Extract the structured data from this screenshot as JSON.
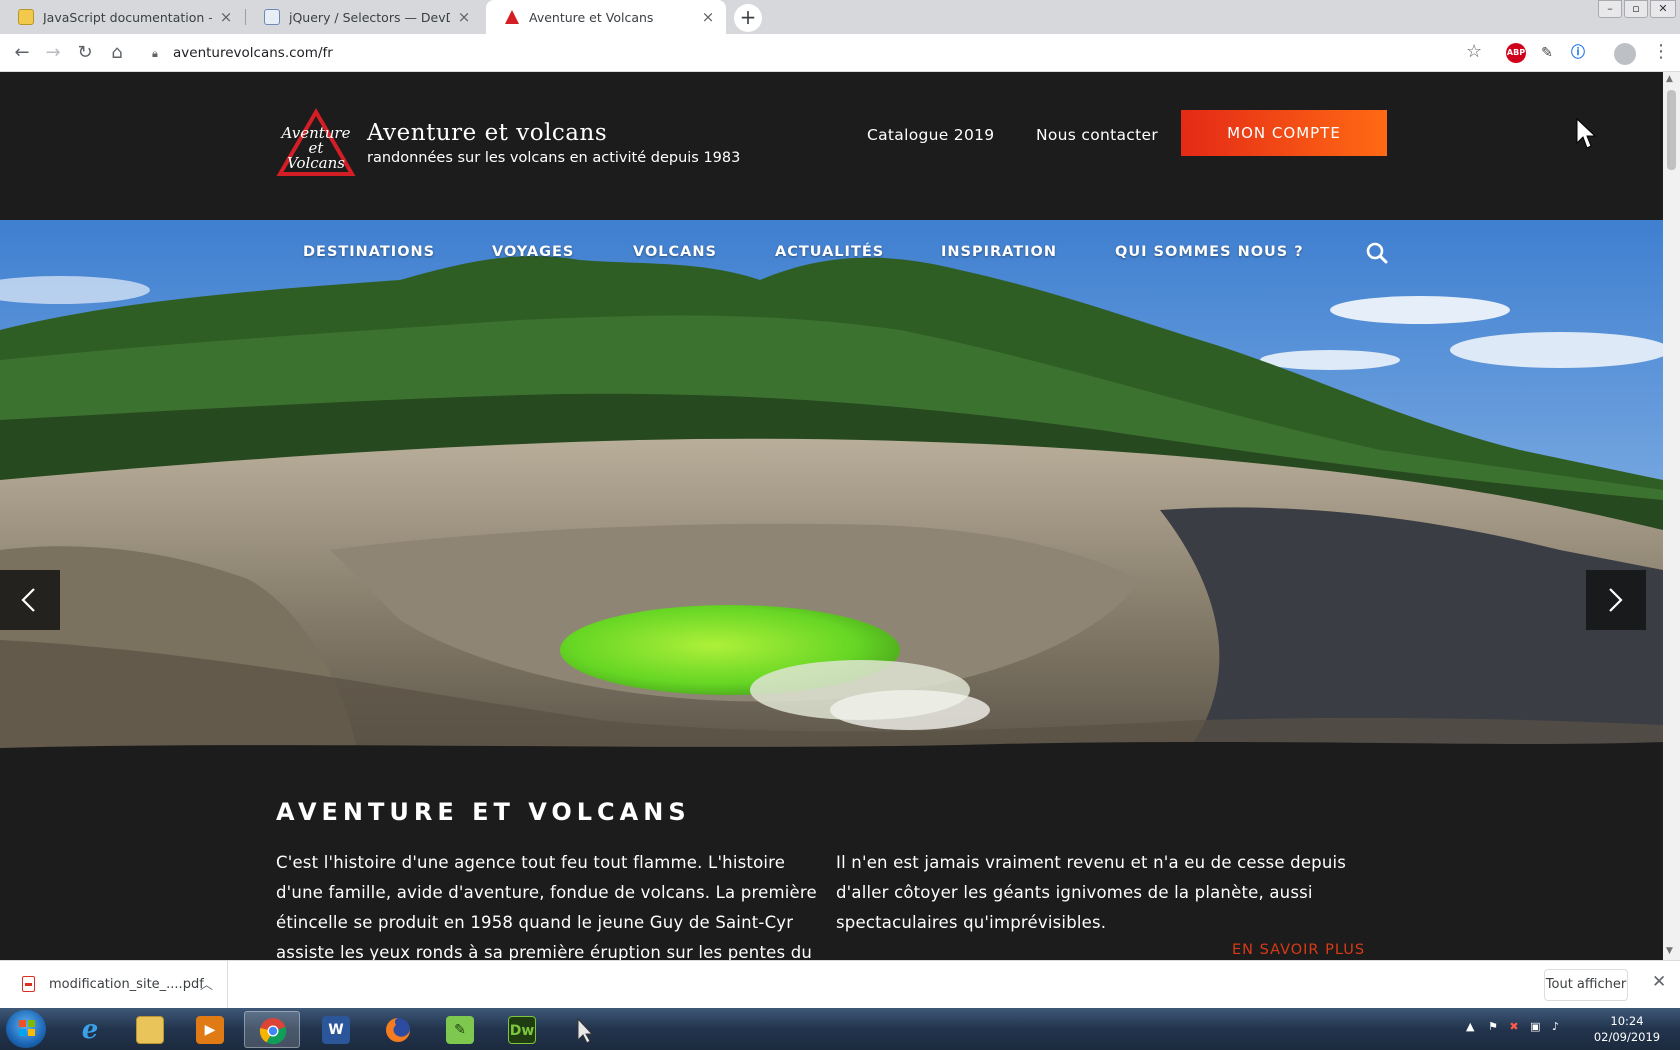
{
  "browser": {
    "tabs": [
      {
        "title": "JavaScript documentation — DevDocs",
        "active": false
      },
      {
        "title": "jQuery / Selectors — DevDocs",
        "active": false
      },
      {
        "title": "Aventure et Volcans",
        "active": true
      }
    ],
    "url": "aventurevolcans.com/fr",
    "extensions": [
      "ABP"
    ]
  },
  "site": {
    "logo_text": [
      "Aventure",
      "et",
      "Volcans"
    ],
    "title": "Aventure et volcans",
    "tagline": "randonnées sur les volcans en activité depuis 1983",
    "header_links": [
      "Catalogue 2019",
      "Nous contacter"
    ],
    "account_button": "MON COMPTE",
    "nav": [
      "DESTINATIONS",
      "VOYAGES",
      "VOLCANS",
      "ACTUALITÉS",
      "INSPIRATION",
      "QUI SOMMES NOUS ?"
    ],
    "section_title": "AVENTURE ET VOLCANS",
    "para_left": "C'est l'histoire d'une agence tout feu tout flamme. L'histoire d'une famille, avide d'aventure, fondue de volcans. La première étincelle se produit en 1958 quand le jeune Guy de Saint-Cyr assiste les yeux ronds à sa première éruption sur les pentes du",
    "para_right": "Il n'en est jamais vraiment revenu et n'a eu de cesse depuis d'aller côtoyer les géants ignivomes de la planète, aussi spectaculaires qu'imprévisibles.",
    "more_link": "EN SAVOIR PLUS"
  },
  "downloads": {
    "file": "modification_site_....pdf",
    "show_all": "Tout afficher"
  },
  "taskbar": {
    "apps": [
      "internet-explorer",
      "file-explorer",
      "media-player",
      "chrome",
      "word",
      "firefox",
      "notepad",
      "dreamweaver",
      "cursor-app"
    ],
    "dreamweaver_label": "Dw",
    "time": "10:24",
    "date": "02/09/2019"
  },
  "colors": {
    "accent": "#e8311a",
    "page_bg": "#1c1c1c",
    "more_link": "#d83b15"
  }
}
